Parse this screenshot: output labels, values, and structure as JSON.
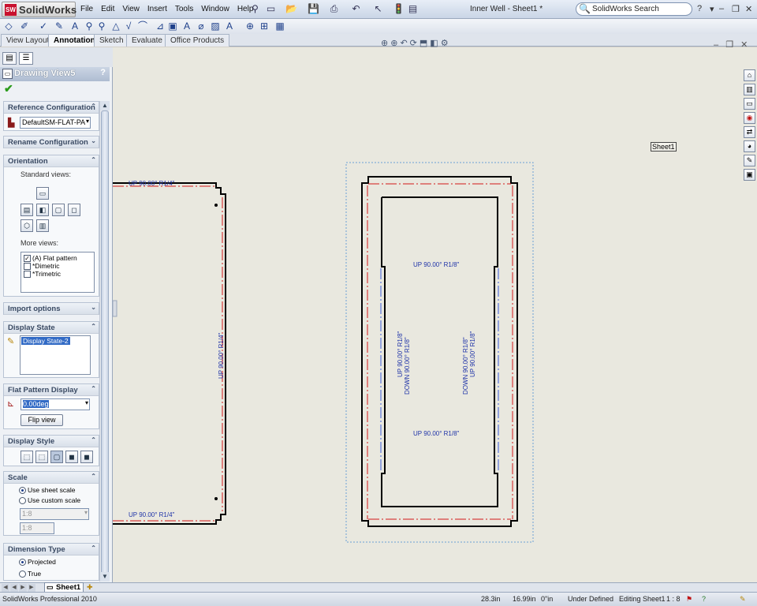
{
  "app": {
    "logo_text": "SolidWorks",
    "document_title": "Inner Well - Sheet1 *",
    "search_placeholder": "SolidWorks Search"
  },
  "menu": [
    "File",
    "Edit",
    "View",
    "Insert",
    "Tools",
    "Window",
    "Help"
  ],
  "cmd_tabs": [
    "View Layout",
    "Annotation",
    "Sketch",
    "Evaluate",
    "Office Products"
  ],
  "active_cmd_tab": "Annotation",
  "property_manager": {
    "title": "Drawing View5",
    "help": "?",
    "reference_configuration": {
      "header": "Reference Configuration",
      "value": "DefaultSM-FLAT-PA"
    },
    "rename_configuration": {
      "header": "Rename Configuration"
    },
    "orientation": {
      "header": "Orientation",
      "standard_views_label": "Standard views:",
      "more_views_label": "More views:",
      "more_views": [
        {
          "label": "(A) Flat pattern",
          "checked": true
        },
        {
          "label": "*Dimetric",
          "checked": false
        },
        {
          "label": "*Trimetric",
          "checked": false
        }
      ]
    },
    "import_options": {
      "header": "Import options"
    },
    "display_state": {
      "header": "Display State",
      "value": "Display State-2"
    },
    "flat_pattern_display": {
      "header": "Flat Pattern Display",
      "angle": "0.00deg",
      "flip_button": "Flip view"
    },
    "display_style": {
      "header": "Display Style"
    },
    "scale": {
      "header": "Scale",
      "options": [
        {
          "label": "Use sheet scale",
          "selected": true
        },
        {
          "label": "Use custom scale",
          "selected": false
        }
      ],
      "custom_value": "1:8",
      "custom_text": "1:8"
    },
    "dimension_type": {
      "header": "Dimension Type",
      "options": [
        {
          "label": "Projected",
          "selected": true
        },
        {
          "label": "True",
          "selected": false
        }
      ]
    }
  },
  "canvas": {
    "sheet_label": "Sheet1",
    "left_view_notes": {
      "top": "UP 90.00° R1/4\"",
      "bottom": "UP 90.00° R1/4\"",
      "side": "UP 90.00° R1/4\""
    },
    "right_view_notes": {
      "top": "UP 90.00° R1/8\"",
      "bottom": "UP 90.00° R1/8\"",
      "left_a": "UP 90.00° R1/8\"",
      "left_b": "DOWN 90.00° R1/8\"",
      "right_a": "DOWN 90.00° R1/8\"",
      "right_b": "UP 90.00° R1/8\""
    }
  },
  "sheet_tab": "Sheet1",
  "status": {
    "product": "SolidWorks Professional 2010",
    "x": "28.3in",
    "y": "16.99in",
    "z": "0\"in",
    "state": "Under Defined",
    "editing": "Editing Sheet1",
    "scale": "1 : 8"
  }
}
